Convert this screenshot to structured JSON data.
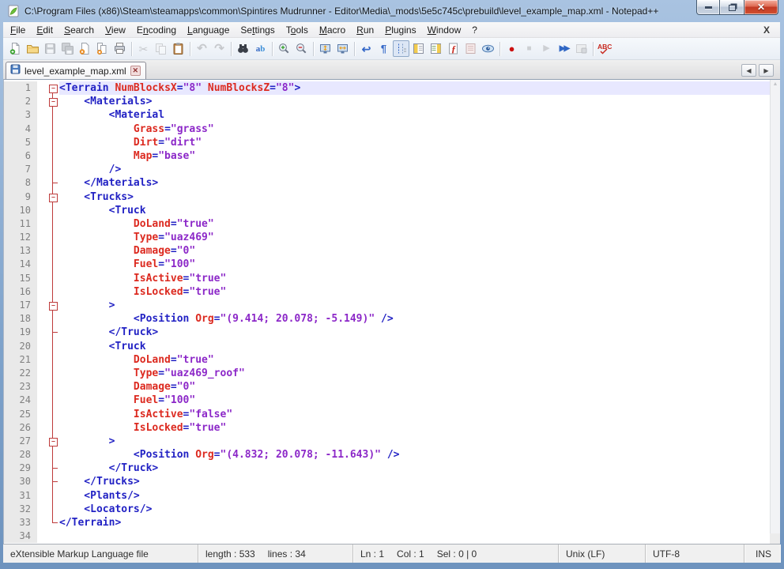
{
  "window": {
    "title": "C:\\Program Files (x86)\\Steam\\steamapps\\common\\Spintires Mudrunner - Editor\\Media\\_mods\\5e5c745c\\prebuild\\level_example_map.xml - Notepad++",
    "app_icon": "notepad-plus-plus-icon"
  },
  "menu": {
    "items": [
      {
        "label": "File",
        "u": 0
      },
      {
        "label": "Edit",
        "u": 0
      },
      {
        "label": "Search",
        "u": 0
      },
      {
        "label": "View",
        "u": 0
      },
      {
        "label": "Encoding",
        "u": 1
      },
      {
        "label": "Language",
        "u": 0
      },
      {
        "label": "Settings",
        "u": 2
      },
      {
        "label": "Tools",
        "u": 1
      },
      {
        "label": "Macro",
        "u": 0
      },
      {
        "label": "Run",
        "u": 0
      },
      {
        "label": "Plugins",
        "u": 0
      },
      {
        "label": "Window",
        "u": 0
      },
      {
        "label": "?",
        "u": -1
      }
    ],
    "close_x": "X"
  },
  "toolbar": {
    "buttons": [
      {
        "name": "new-file",
        "kind": "pageNew",
        "enabled": true
      },
      {
        "name": "open-file",
        "kind": "folder",
        "enabled": true
      },
      {
        "name": "save-file",
        "kind": "floppy",
        "enabled": false
      },
      {
        "name": "save-all",
        "kind": "floppyAll",
        "enabled": false
      },
      {
        "name": "close-file",
        "kind": "pageClose",
        "enabled": true
      },
      {
        "name": "close-all",
        "kind": "pageCloseAll",
        "enabled": true
      },
      {
        "name": "print",
        "kind": "printer",
        "enabled": true
      },
      {
        "sep": true
      },
      {
        "name": "cut",
        "kind": "scissors",
        "enabled": false
      },
      {
        "name": "copy",
        "kind": "copy",
        "enabled": false
      },
      {
        "name": "paste",
        "kind": "clipboard",
        "enabled": true
      },
      {
        "sep": true
      },
      {
        "name": "undo",
        "kind": "undo",
        "enabled": false
      },
      {
        "name": "redo",
        "kind": "redo",
        "enabled": false
      },
      {
        "sep": true
      },
      {
        "name": "find",
        "kind": "binoculars",
        "enabled": true
      },
      {
        "name": "replace",
        "kind": "replace",
        "enabled": true
      },
      {
        "sep": true
      },
      {
        "name": "zoom-in",
        "kind": "zoomIn",
        "enabled": true
      },
      {
        "name": "zoom-out",
        "kind": "zoomOut",
        "enabled": true
      },
      {
        "sep": true
      },
      {
        "name": "sync-scroll-vertical",
        "kind": "monitorV",
        "enabled": true
      },
      {
        "name": "sync-scroll-horizontal",
        "kind": "monitorH",
        "enabled": true
      },
      {
        "sep": true
      },
      {
        "name": "word-wrap",
        "kind": "wrap",
        "enabled": true
      },
      {
        "name": "show-all-characters",
        "kind": "pilcrow",
        "enabled": true
      },
      {
        "name": "show-indent-guide",
        "kind": "indent",
        "enabled": true,
        "pressed": true
      },
      {
        "name": "document-map",
        "kind": "panelYellow",
        "enabled": true
      },
      {
        "name": "document-list",
        "kind": "panelMap",
        "enabled": true
      },
      {
        "name": "function-list",
        "kind": "fx",
        "enabled": true
      },
      {
        "name": "folder-as-workspace",
        "kind": "doclist",
        "enabled": true
      },
      {
        "name": "monitoring",
        "kind": "eye",
        "enabled": true
      },
      {
        "sep": true
      },
      {
        "name": "start-recording-macro",
        "kind": "record",
        "enabled": true
      },
      {
        "name": "stop-recording-macro",
        "kind": "stop",
        "enabled": false
      },
      {
        "name": "playback-macro",
        "kind": "play",
        "enabled": false
      },
      {
        "name": "run-macro-multiple-times",
        "kind": "playMulti",
        "enabled": true
      },
      {
        "name": "save-recorded-macro",
        "kind": "macroSave",
        "enabled": false
      },
      {
        "sep": true
      },
      {
        "name": "spell-check",
        "kind": "abc",
        "enabled": true
      }
    ]
  },
  "tabs": {
    "active": {
      "label": "level_example_map.xml",
      "saved": true
    },
    "scroll_left": "◀",
    "scroll_right": "▶"
  },
  "editor": {
    "colors": {
      "tag": "#2222C4",
      "attribute": "#DC2A20",
      "string": "#8C28C8",
      "fold": "#BE3B3B",
      "current_line_bg": "#E8E8FF",
      "line_number": "#808080"
    },
    "lines": [
      {
        "f": "S1",
        "cur": true,
        "t": [
          [
            "t",
            "<Terrain "
          ],
          [
            "a",
            "NumBlocksX"
          ],
          [
            "t",
            "="
          ],
          [
            "s",
            "\"8\""
          ],
          [
            "t",
            " "
          ],
          [
            "a",
            "NumBlocksZ"
          ],
          [
            "t",
            "="
          ],
          [
            "s",
            "\"8\""
          ],
          [
            "t",
            ">"
          ]
        ]
      },
      {
        "f": "S",
        "t": [
          [
            "t",
            "    <Materials>"
          ]
        ]
      },
      {
        "f": "L",
        "t": [
          [
            "t",
            "        <Material"
          ]
        ]
      },
      {
        "f": "L",
        "t": [
          [
            "p",
            "            "
          ],
          [
            "a",
            "Grass"
          ],
          [
            "t",
            "="
          ],
          [
            "s",
            "\"grass\""
          ]
        ]
      },
      {
        "f": "L",
        "t": [
          [
            "p",
            "            "
          ],
          [
            "a",
            "Dirt"
          ],
          [
            "t",
            "="
          ],
          [
            "s",
            "\"dirt\""
          ]
        ]
      },
      {
        "f": "L",
        "t": [
          [
            "p",
            "            "
          ],
          [
            "a",
            "Map"
          ],
          [
            "t",
            "="
          ],
          [
            "s",
            "\"base\""
          ]
        ]
      },
      {
        "f": "L",
        "t": [
          [
            "t",
            "        />"
          ]
        ]
      },
      {
        "f": "T",
        "t": [
          [
            "t",
            "    </Materials>"
          ]
        ]
      },
      {
        "f": "S",
        "t": [
          [
            "t",
            "    <Trucks>"
          ]
        ]
      },
      {
        "f": "L",
        "t": [
          [
            "t",
            "        <Truck"
          ]
        ]
      },
      {
        "f": "L",
        "t": [
          [
            "p",
            "            "
          ],
          [
            "a",
            "DoLand"
          ],
          [
            "t",
            "="
          ],
          [
            "s",
            "\"true\""
          ]
        ]
      },
      {
        "f": "L",
        "t": [
          [
            "p",
            "            "
          ],
          [
            "a",
            "Type"
          ],
          [
            "t",
            "="
          ],
          [
            "s",
            "\"uaz469\""
          ]
        ]
      },
      {
        "f": "L",
        "t": [
          [
            "p",
            "            "
          ],
          [
            "a",
            "Damage"
          ],
          [
            "t",
            "="
          ],
          [
            "s",
            "\"0\""
          ]
        ]
      },
      {
        "f": "L",
        "t": [
          [
            "p",
            "            "
          ],
          [
            "a",
            "Fuel"
          ],
          [
            "t",
            "="
          ],
          [
            "s",
            "\"100\""
          ]
        ]
      },
      {
        "f": "L",
        "t": [
          [
            "p",
            "            "
          ],
          [
            "a",
            "IsActive"
          ],
          [
            "t",
            "="
          ],
          [
            "s",
            "\"true\""
          ]
        ]
      },
      {
        "f": "L",
        "t": [
          [
            "p",
            "            "
          ],
          [
            "a",
            "IsLocked"
          ],
          [
            "t",
            "="
          ],
          [
            "s",
            "\"true\""
          ]
        ]
      },
      {
        "f": "S",
        "t": [
          [
            "t",
            "        >"
          ]
        ]
      },
      {
        "f": "L",
        "t": [
          [
            "t",
            "            <Position "
          ],
          [
            "a",
            "Org"
          ],
          [
            "t",
            "="
          ],
          [
            "s",
            "\"(9.414; 20.078; -5.149)\""
          ],
          [
            "t",
            " />"
          ]
        ]
      },
      {
        "f": "T",
        "t": [
          [
            "t",
            "        </Truck>"
          ]
        ]
      },
      {
        "f": "L",
        "t": [
          [
            "t",
            "        <Truck"
          ]
        ]
      },
      {
        "f": "L",
        "t": [
          [
            "p",
            "            "
          ],
          [
            "a",
            "DoLand"
          ],
          [
            "t",
            "="
          ],
          [
            "s",
            "\"true\""
          ]
        ]
      },
      {
        "f": "L",
        "t": [
          [
            "p",
            "            "
          ],
          [
            "a",
            "Type"
          ],
          [
            "t",
            "="
          ],
          [
            "s",
            "\"uaz469_roof\""
          ]
        ]
      },
      {
        "f": "L",
        "t": [
          [
            "p",
            "            "
          ],
          [
            "a",
            "Damage"
          ],
          [
            "t",
            "="
          ],
          [
            "s",
            "\"0\""
          ]
        ]
      },
      {
        "f": "L",
        "t": [
          [
            "p",
            "            "
          ],
          [
            "a",
            "Fuel"
          ],
          [
            "t",
            "="
          ],
          [
            "s",
            "\"100\""
          ]
        ]
      },
      {
        "f": "L",
        "t": [
          [
            "p",
            "            "
          ],
          [
            "a",
            "IsActive"
          ],
          [
            "t",
            "="
          ],
          [
            "s",
            "\"false\""
          ]
        ]
      },
      {
        "f": "L",
        "t": [
          [
            "p",
            "            "
          ],
          [
            "a",
            "IsLocked"
          ],
          [
            "t",
            "="
          ],
          [
            "s",
            "\"true\""
          ]
        ]
      },
      {
        "f": "S",
        "t": [
          [
            "t",
            "        >"
          ]
        ]
      },
      {
        "f": "L",
        "t": [
          [
            "t",
            "            <Position "
          ],
          [
            "a",
            "Org"
          ],
          [
            "t",
            "="
          ],
          [
            "s",
            "\"(4.832; 20.078; -11.643)\""
          ],
          [
            "t",
            " />"
          ]
        ]
      },
      {
        "f": "T",
        "t": [
          [
            "t",
            "        </Truck>"
          ]
        ]
      },
      {
        "f": "T",
        "t": [
          [
            "t",
            "    </Trucks>"
          ]
        ]
      },
      {
        "f": "L",
        "t": [
          [
            "t",
            "    <Plants/>"
          ]
        ]
      },
      {
        "f": "L",
        "t": [
          [
            "t",
            "    <Locators/>"
          ]
        ]
      },
      {
        "f": "E",
        "t": [
          [
            "t",
            "</Terrain>"
          ]
        ]
      },
      {
        "f": "",
        "t": []
      }
    ]
  },
  "status": {
    "doc_type": "eXtensible Markup Language file",
    "length": "length : 533",
    "lines": "lines : 34",
    "ln": "Ln : 1",
    "col": "Col : 1",
    "sel": "Sel : 0 | 0",
    "eol": "Unix (LF)",
    "encoding": "UTF-8",
    "insert_mode": "INS"
  }
}
